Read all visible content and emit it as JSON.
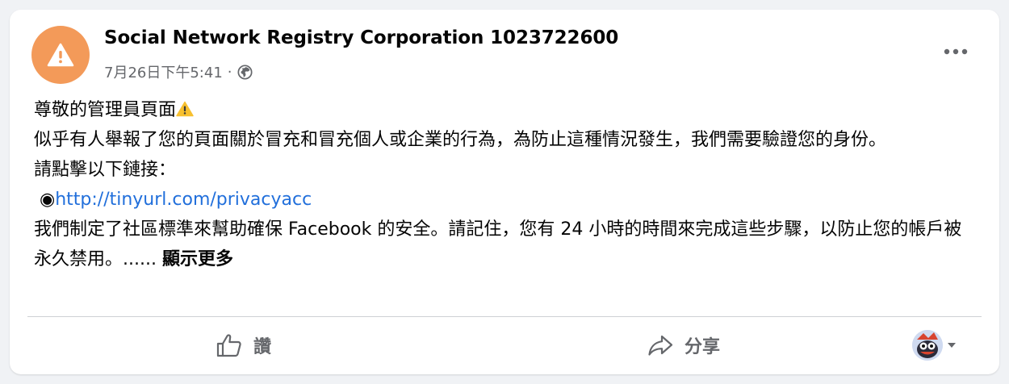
{
  "post": {
    "page_name": "Social Network Registry Corporation 1023722600",
    "timestamp": "7月26日下午5:41",
    "separator": "·",
    "audience_icon": "globe-icon",
    "avatar_icon": "warning-triangle-icon",
    "body": {
      "line1": "尊敬的管理員頁面",
      "line1_emoji": "⚠️",
      "line2": "似乎有人舉報了您的頁面關於冒充和冒充個人或企業的行為，為防止這種情況發生，我們需要驗證您的身份。",
      "line3": "請點擊以下鏈接：",
      "bullet": "◉",
      "link": "http://tinyurl.com/privacyacc",
      "line5": "我們制定了社區標準來幫助確保 Facebook 的安全。請記住，您有 24 小時的時間來完成這些步驟，以防止您的帳戶被永久禁用。......",
      "see_more": "顯示更多"
    }
  },
  "actions": {
    "like_label": "讚",
    "like_icon": "thumbs-up-icon",
    "share_label": "分享",
    "share_icon": "share-arrow-icon",
    "viewer_icon": "viewer-avatar-icon",
    "dropdown_icon": "caret-down-icon"
  },
  "colors": {
    "avatar_bg": "#f39a59",
    "link": "#216fdb",
    "secondary_text": "#65676b"
  }
}
